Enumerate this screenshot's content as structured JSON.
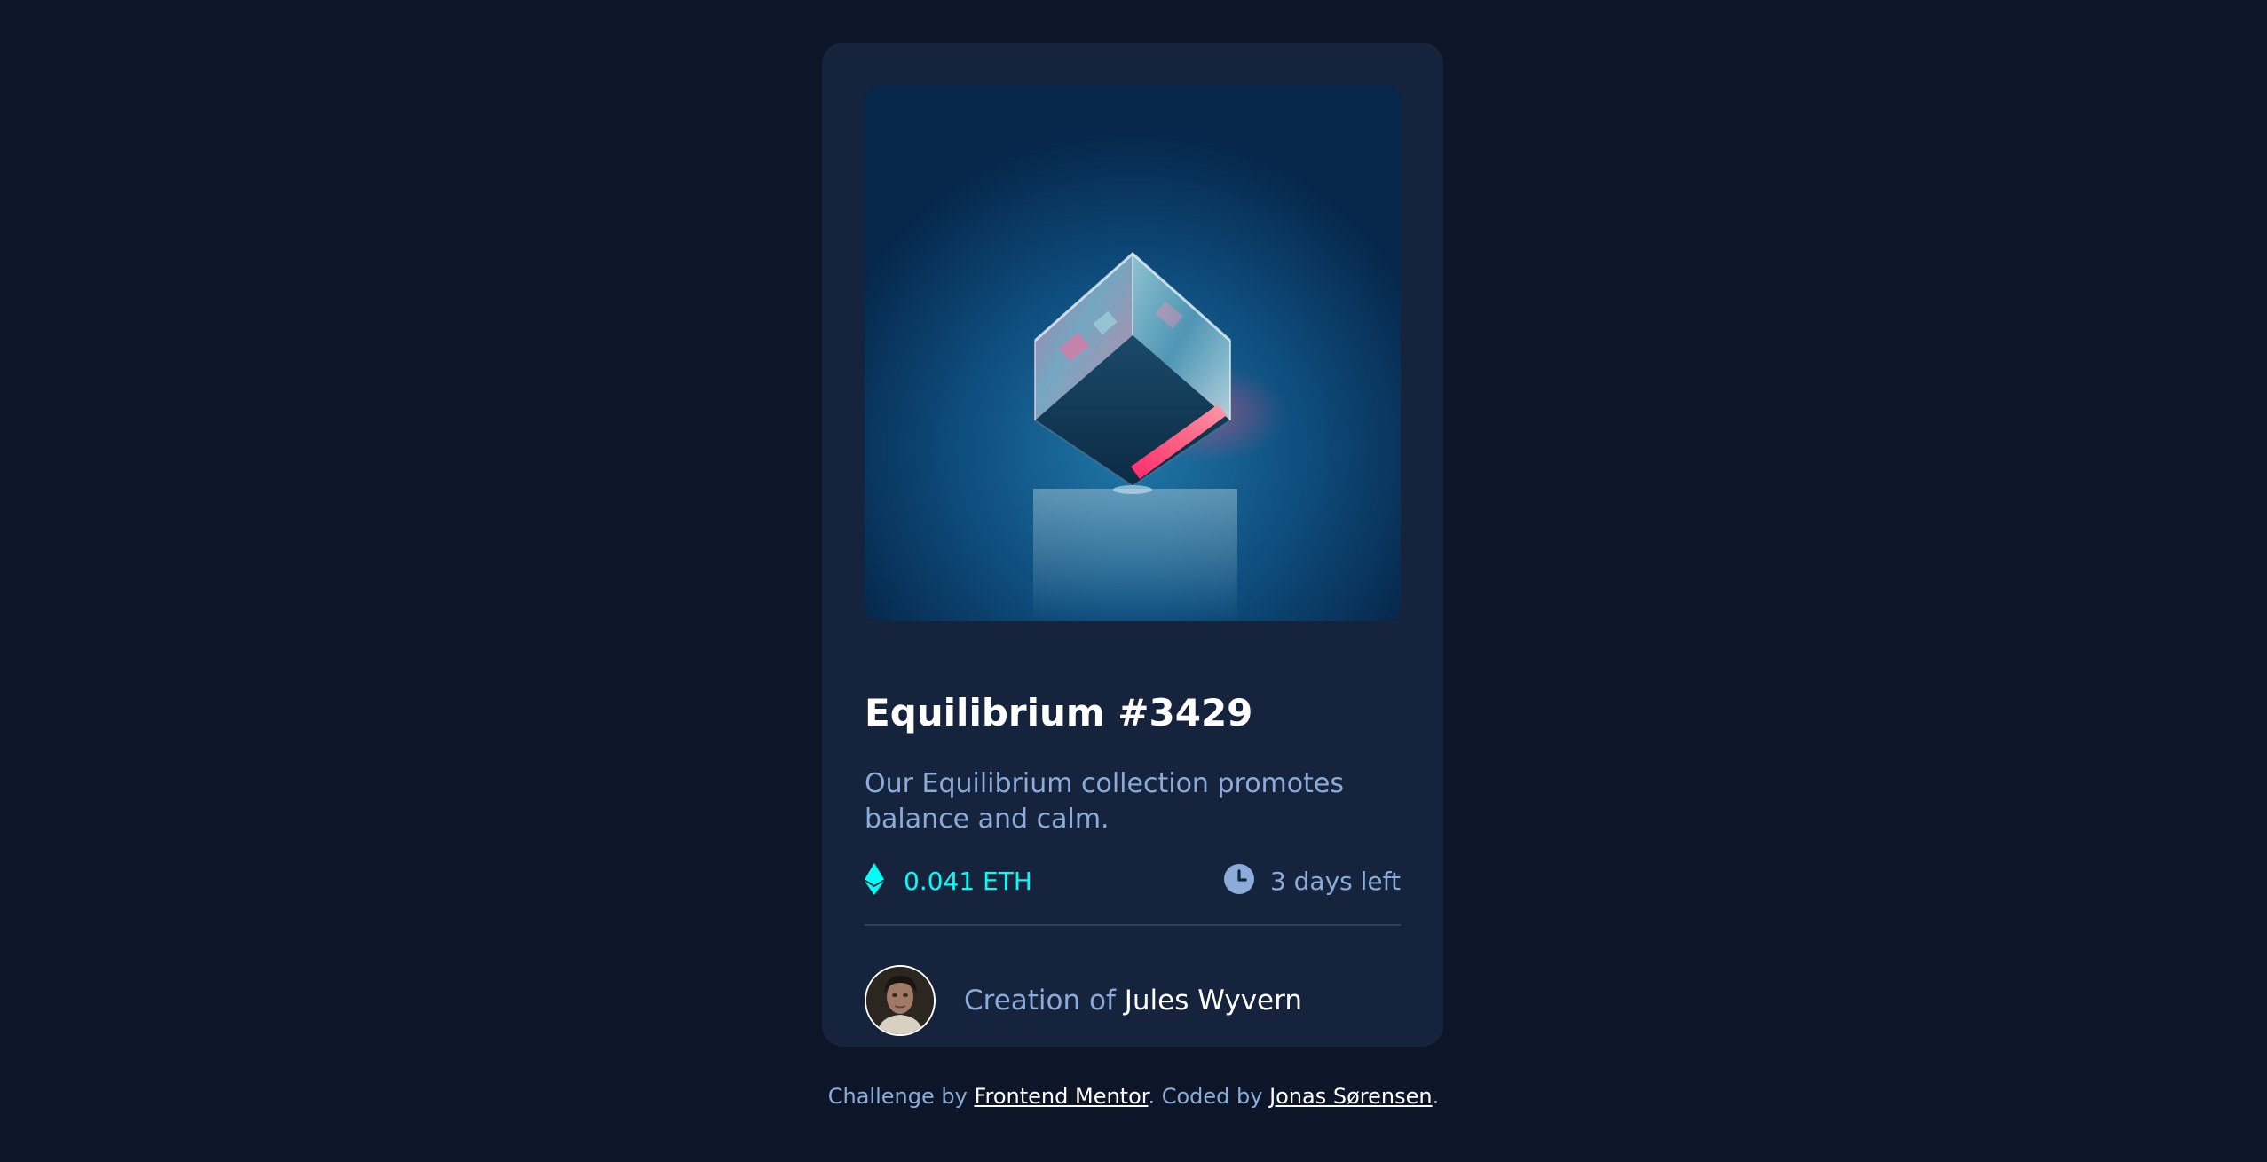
{
  "card": {
    "title": "Equilibrium #3429",
    "description": "Our Equilibrium collection promotes balance and calm.",
    "price": "0.041 ETH",
    "time_left": "3 days left",
    "creator_prefix": "Creation of",
    "creator_name": "Jules Wyvern"
  },
  "attribution": {
    "prefix": "Challenge by",
    "link1": "Frontend Mentor",
    "middle": ". Coded by",
    "link2": "Jonas Sørensen",
    "suffix": "."
  },
  "icons": {
    "price": "ethereum-icon",
    "time": "clock-icon"
  },
  "colors": {
    "background": "#0d1628",
    "card": "#15233d",
    "accent_cyan": "#00fff8",
    "soft_blue": "#8bacd9",
    "white": "#ffffff"
  }
}
